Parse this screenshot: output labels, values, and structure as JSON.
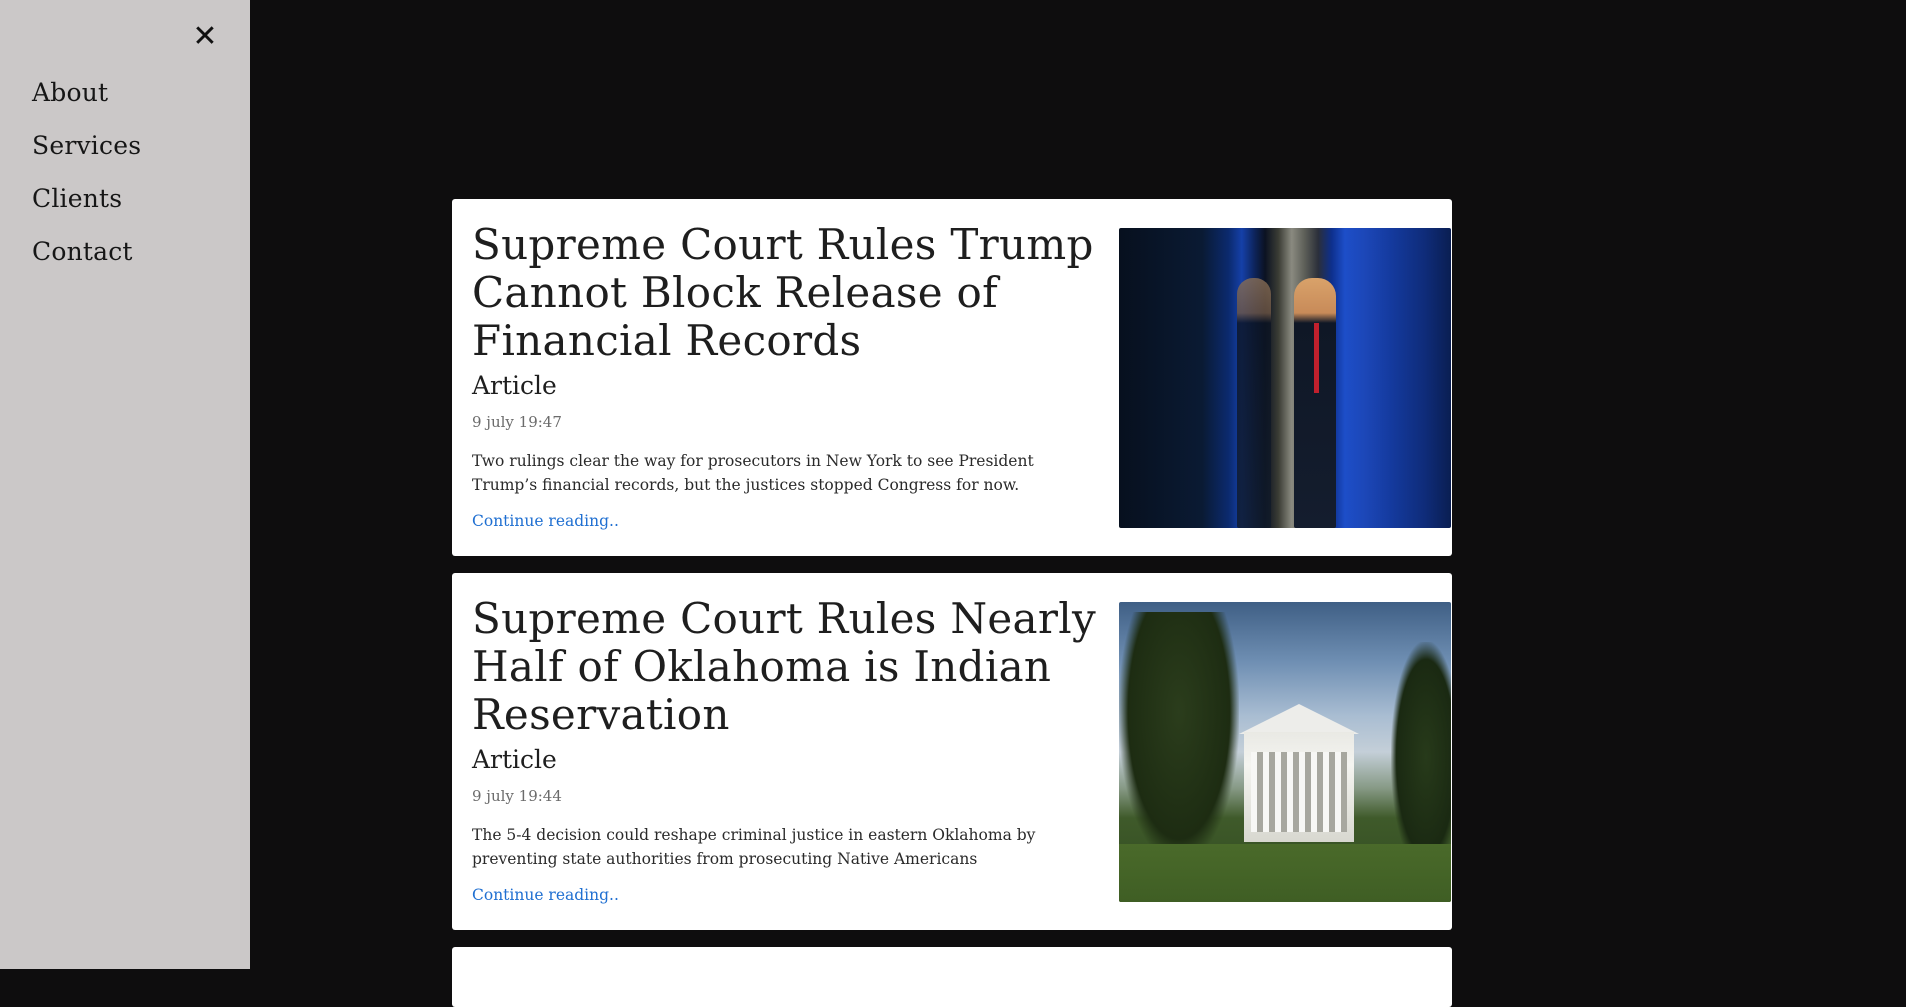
{
  "sidebar": {
    "close_icon": "close-icon",
    "items": [
      {
        "label": "About"
      },
      {
        "label": "Services"
      },
      {
        "label": "Clients"
      },
      {
        "label": "Contact"
      }
    ]
  },
  "colors": {
    "page_background": "#0e0d0e",
    "sidebar_background": "#cbc8c8",
    "link": "#1f6fd1"
  },
  "articles": [
    {
      "title": "Supreme Court Rules Trump Cannot Block Release of Financial Records",
      "type": "Article",
      "date": "9 july 19:47",
      "summary": "Two rulings clear the way for prosecutors in New York to see President Trump’s financial records, but the justices stopped Congress for now.",
      "link_label": "Continue reading.."
    },
    {
      "title": "Supreme Court Rules Nearly Half of Oklahoma is Indian Reservation",
      "type": "Article",
      "date": "9 july 19:44",
      "summary": "The 5-4 decision could reshape criminal justice in eastern Oklahoma by preventing state authorities from prosecuting Native Americans",
      "link_label": "Continue reading.."
    }
  ]
}
